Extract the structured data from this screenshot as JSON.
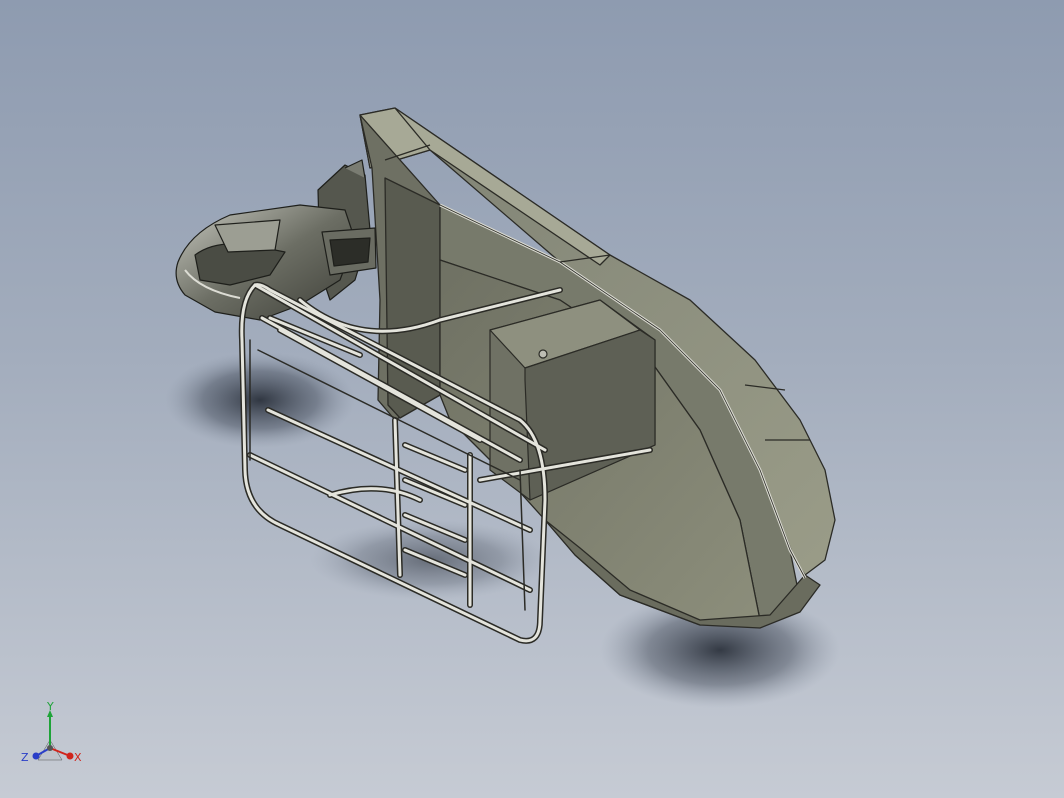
{
  "viewport": {
    "background_top": "#8e9bb0",
    "background_bottom": "#c6cbd4",
    "model_fill": "#8d8f7d",
    "model_edge": "#2b2b26",
    "rail_color": "#e2e2da"
  },
  "triad": {
    "x_label": "X",
    "y_label": "Y",
    "z_label": "Z",
    "x_color": "#d0241c",
    "y_color": "#1ea338",
    "z_color": "#2a3ec8"
  }
}
